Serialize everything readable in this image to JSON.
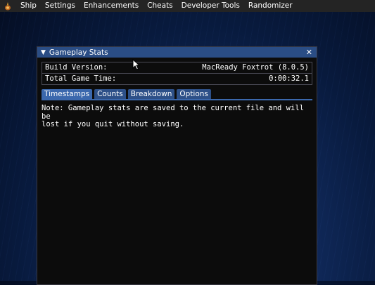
{
  "menubar": {
    "logo_icon": "app-logo-icon",
    "items": [
      "Ship",
      "Settings",
      "Enhancements",
      "Cheats",
      "Developer Tools",
      "Randomizer"
    ]
  },
  "window": {
    "title": "Gameplay Stats",
    "collapse_icon": "triangle-down-icon",
    "close_icon": "close-icon",
    "info_rows": [
      {
        "label": "Build Version:",
        "value": "MacReady Foxtrot (8.0.5)"
      },
      {
        "label": "Total Game Time:",
        "value": "0:00:32.1"
      }
    ],
    "tabs": [
      "Timestamps",
      "Counts",
      "Breakdown",
      "Options"
    ],
    "active_tab": "Timestamps",
    "note": "Note: Gameplay stats are saved to the current file and will be\nlost if you quit without saving."
  },
  "colors": {
    "menubar_bg": "#242424",
    "titlebar_bg": "#2a4d85",
    "tab_bg": "#2d5088",
    "tab_active_bg": "#3b68ad",
    "window_bg": "#0c0c0c"
  }
}
